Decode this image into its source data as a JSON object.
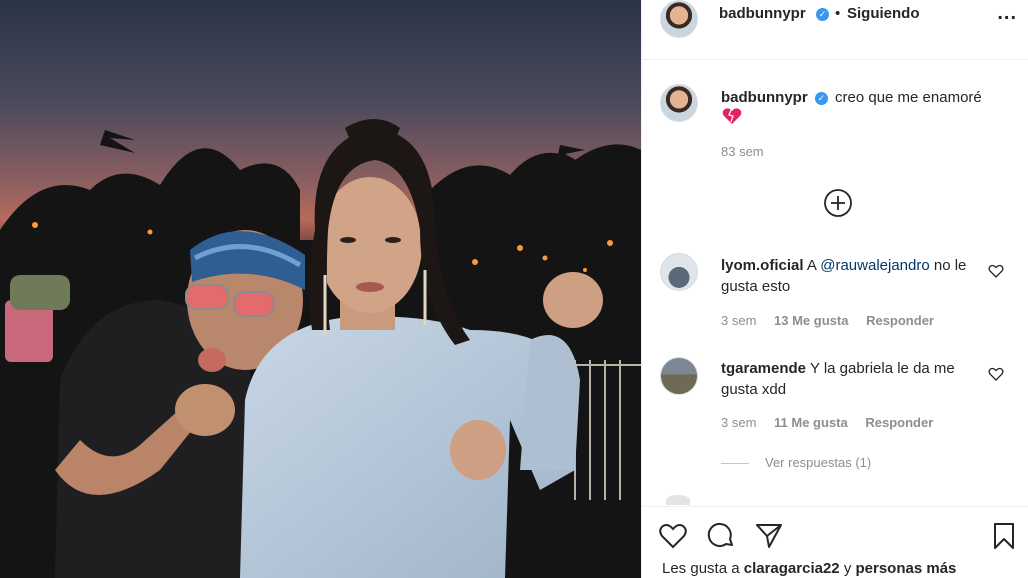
{
  "post": {
    "author": "badbunnypr",
    "follow_status": "Siguiendo",
    "follow_separator": "•",
    "more_menu": "...",
    "caption_author": "badbunnypr",
    "caption_text": "creo que me enamoré",
    "caption_emoji": "heart-emoji",
    "caption_time": "83 sem",
    "load_more_icon": "plus-circle-icon"
  },
  "comments": [
    {
      "user": "lyom.oficial",
      "prefix": "A",
      "mention": "@rauwalejandro",
      "text": "no le gusta esto",
      "time": "3 sem",
      "likes": "13 Me gusta",
      "reply": "Responder"
    },
    {
      "user": "tgaramende",
      "prefix": "",
      "mention": "",
      "text": "Y la gabriela le da me gusta xdd",
      "time": "3 sem",
      "likes": "11 Me gusta",
      "reply": "Responder"
    }
  ],
  "view_replies": "Ver respuestas (1)",
  "actions": {
    "like_icon": "heart-icon",
    "comment_icon": "comment-icon",
    "share_icon": "paper-plane-icon",
    "save_icon": "bookmark-icon"
  },
  "likes_line": {
    "prefix": "Les gusta a",
    "user": "claragarcia22",
    "connector": "y",
    "others": "personas más"
  },
  "colors": {
    "verified": "#3897f0",
    "mention": "#00376b",
    "muted": "#8e8e8e",
    "text": "#262626"
  }
}
